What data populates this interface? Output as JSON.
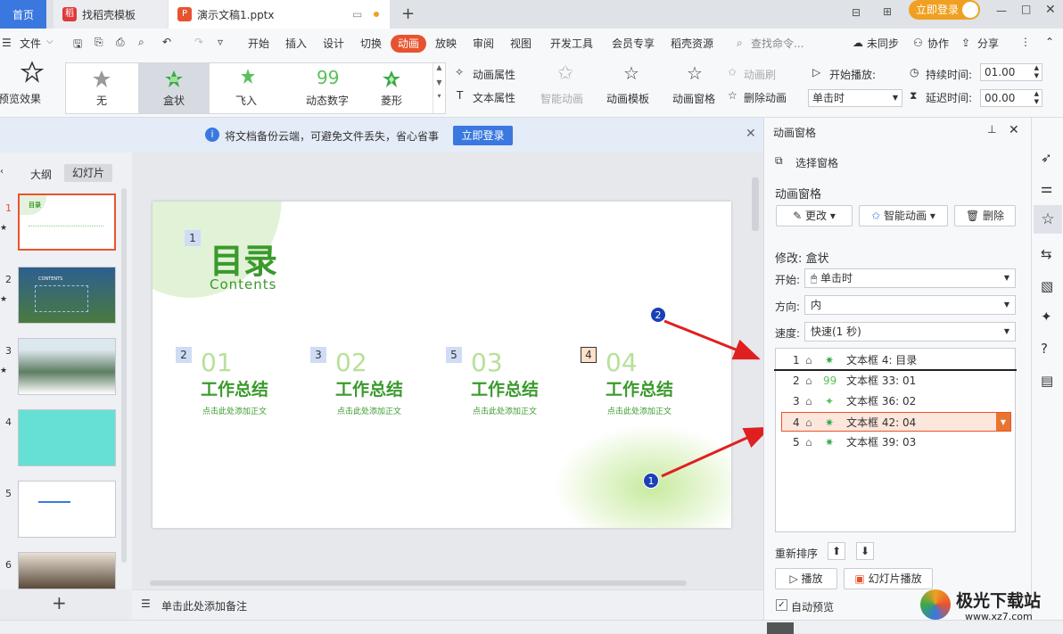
{
  "tabs": {
    "home": "首页",
    "template": "找稻壳模板",
    "doc": "演示文稿1.pptx"
  },
  "titlebar": {
    "login": "立即登录"
  },
  "menu": {
    "file": "文件",
    "items": [
      "开始",
      "插入",
      "设计",
      "切换",
      "动画",
      "放映",
      "审阅",
      "视图",
      "开发工具",
      "会员专享",
      "稻壳资源"
    ],
    "search": "查找命令...",
    "unsync": "未同步",
    "collab": "协作",
    "share": "分享"
  },
  "ribbon": {
    "preview": "预览效果",
    "gallery": [
      "无",
      "盒状",
      "飞入",
      "动态数字",
      "菱形"
    ],
    "anim_props": "动画属性",
    "text_props": "文本属性",
    "smart_anim": "智能动画",
    "anim_template": "动画模板",
    "anim_pane": "动画窗格",
    "anim_brush": "动画刷",
    "delete_anim": "删除动画",
    "start_play": "开始播放:",
    "on_click": "单击时",
    "duration": "持续时间:",
    "duration_val": "01.00",
    "delay": "延迟时间:",
    "delay_val": "00.00"
  },
  "infobar": {
    "text": "将文档备份云端，可避免文件丢失，省心省事",
    "button": "立即登录"
  },
  "leftpane": {
    "outline": "大纲",
    "slides": "幻灯片",
    "numbers": [
      "1",
      "2",
      "3",
      "4",
      "5",
      "6"
    ]
  },
  "slide": {
    "title": "目录",
    "subtitle": "Contents",
    "sections": [
      {
        "badge": "2",
        "num": "01",
        "title": "工作总结",
        "sub": "点击此处添加正文"
      },
      {
        "badge": "3",
        "num": "02",
        "title": "工作总结",
        "sub": "点击此处添加正文"
      },
      {
        "badge": "5",
        "num": "03",
        "title": "工作总结",
        "sub": "点击此处添加正文"
      },
      {
        "badge": "4",
        "num": "04",
        "title": "工作总结",
        "sub": "点击此处添加正文"
      }
    ],
    "title_badge": "1"
  },
  "thumb": {
    "t1": "目录",
    "t2": "CONTENTS"
  },
  "notes": {
    "placeholder": "单击此处添加备注"
  },
  "panel": {
    "header": "动画窗格",
    "select_pane": "选择窗格",
    "section": "动画窗格",
    "change": "更改",
    "smart": "智能动画",
    "delete": "删除",
    "modify": "修改: 盒状",
    "start_lbl": "开始:",
    "start_val": "单击时",
    "dir_lbl": "方向:",
    "dir_val": "内",
    "speed_lbl": "速度:",
    "speed_val": "快速(1 秒)",
    "list": [
      {
        "n": "1",
        "t": "文本框 4: 目录"
      },
      {
        "n": "2",
        "t": "文本框 33: 01"
      },
      {
        "n": "3",
        "t": "文本框 36: 02"
      },
      {
        "n": "4",
        "t": "文本框 42: 04"
      },
      {
        "n": "5",
        "t": "文本框 39: 03"
      }
    ],
    "reorder": "重新排序",
    "play": "播放",
    "slideshow": "幻灯片播放",
    "autopreview": "自动预览"
  },
  "annotations": {
    "a1": "1",
    "a2": "2"
  },
  "watermark": {
    "title": "极光下载站",
    "url": "www.xz7.com"
  },
  "colors": {
    "accent": "#e8532f",
    "green": "#3a9a2c",
    "blue": "#3a78e0"
  }
}
